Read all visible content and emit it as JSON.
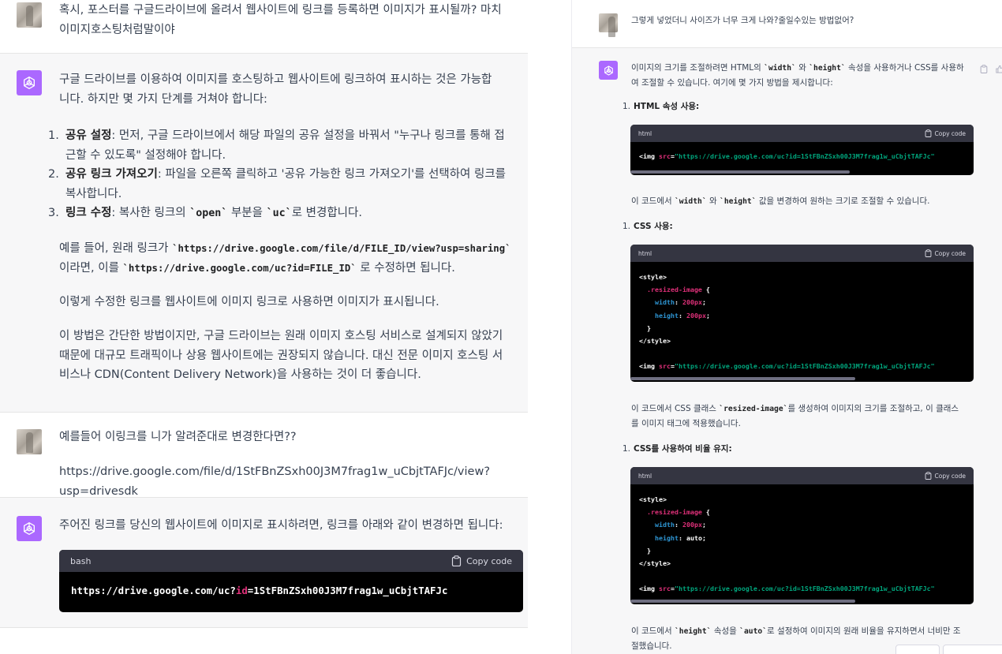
{
  "left": {
    "msg1_user": {
      "line1": "혹시, 포스터를 구글드라이브에 올려서 웹사이트에 링크를 등록하면 이미지가 표시될까? 마치",
      "line2": "이미지호스팅처럼말이야"
    },
    "msg2_bot": {
      "intro1": "구글 드라이브를 이용하여 이미지를 호스팅하고 웹사이트에 링크하여 표시하는 것은 가능합",
      "intro2": "니다. 하지만 몇 가지 단계를 거쳐야 합니다:",
      "steps": [
        {
          "num": "1.",
          "title": "공유 설정",
          "line1": ": 먼저, 구글 드라이브에서 해당 파일의 공유 설정을 바꿔서 \"누구나 링크를 통해 접",
          "line2": "근할 수 있도록\" 설정해야 합니다."
        },
        {
          "num": "2.",
          "title": "공유 링크 가져오기",
          "line1": ": 파일을 오른쪽 클릭하고 '공유 가능한 링크 가져오기'를 선택하여 링크를",
          "line2": "복사합니다."
        },
        {
          "num": "3.",
          "title": "링크 수정",
          "pre": ": 복사한 링크의 ",
          "code1": "`open`",
          "mid": " 부분을 ",
          "code2": "`uc`",
          "post": "로 변경합니다."
        }
      ],
      "example_pre": "예를 들어, 원래 링크가 ",
      "example_code1": "`https://drive.google.com/file/d/FILE_ID/view?usp=sharing`",
      "example_mid": "이라면, 이를 ",
      "example_code2": "`https://drive.google.com/uc?id=FILE_ID`",
      "example_post": " 로 수정하면 됩니다.",
      "para2": "이렇게 수정한 링크를 웹사이트에 이미지 링크로 사용하면 이미지가 표시됩니다.",
      "para3_l1": "이 방법은 간단한 방법이지만, 구글 드라이브는 원래 이미지 호스팅 서비스로 설계되지 않았기",
      "para3_l2": "때문에 대규모 트래픽이나 상용 웹사이트에는 권장되지 않습니다. 대신 전문 이미지 호스팅 서",
      "para3_l3": "비스나 CDN(Content Delivery Network)을 사용하는 것이 더 좋습니다."
    },
    "msg3_user": {
      "line1": "예를들어 이링크를 니가 알려준대로 변경한다면??",
      "line2": "https://drive.google.com/file/d/1StFBnZSxh00J3M7frag1w_uCbjtTAFJc/view?usp=drivesdk"
    },
    "msg4_bot": {
      "text": "주어진 링크를 당신의 웹사이트에 이미지로 표시하려면, 링크를 아래와 같이 변경하면 됩니다:",
      "code_lang": "bash",
      "copy_label": "Copy code",
      "code_pre": "https://drive.google.com/uc?",
      "code_kw": "id",
      "code_post": "=1StFBnZSxh00J3M7frag1w_uCbjtTAFJc"
    }
  },
  "right": {
    "msg1_user": {
      "text": "그렇게 넣었더니 사이즈가 너무 크게 나와?줄일수있는 방법없어?"
    },
    "msg2_bot": {
      "intro_pre": "이미지의 크기를 조절하려면 HTML의 ",
      "intro_c1": "`width`",
      "intro_and": " 와 ",
      "intro_c2": "`height`",
      "intro_post": " 속성을 사용하거나 CSS를 사용하",
      "intro_l2": "여 조절할 수 있습니다. 여기에 몇 가지 방법을 제시합니다:",
      "s1_num": "1.",
      "s1_title": "HTML 속성 사용:",
      "code_lang": "html",
      "copy_label": "Copy code",
      "code1_tag": "<img",
      "code1_attr": "src",
      "code1_eq": "=",
      "code1_str": "\"https://drive.google.com/uc?id=1StFBnZSxh00J3M7frag1w_uCbjtTAFJc\"",
      "after1_pre": "이 코드에서 ",
      "after1_c1": "`width`",
      "after1_and": " 와 ",
      "after1_c2": "`height`",
      "after1_post": " 값을 변경하여 원하는 크기로 조절할 수 있습니다.",
      "s2_num": "1.",
      "s2_title": "CSS 사용:",
      "code2": {
        "l1": "<style>",
        "l2_sel": ".resized-image",
        "l2_brace": " {",
        "l3_prop": "width",
        "l3_colon": ": ",
        "l3_val": "200px",
        "l3_semi": ";",
        "l4_prop": "height",
        "l4_colon": ": ",
        "l4_val": "200px",
        "l4_semi": ";",
        "l5": "}",
        "l6": "</style>",
        "l7_tag": "<img",
        "l7_attr": "src",
        "l7_eq": "=",
        "l7_str": "\"https://drive.google.com/uc?id=1StFBnZSxh00J3M7frag1w_uCbjtTAFJc\""
      },
      "after2_pre": "이 코드에서 CSS 클래스 ",
      "after2_c1": "`resized-image`",
      "after2_post": "를 생성하여 이미지의 크기를 조절하고, 이 클래스",
      "after2_l2": "를 이미지 태그에 적용했습니다.",
      "s3_num": "1.",
      "s3_title": "CSS를 사용하여 비율 유지:",
      "code3": {
        "l1": "<style>",
        "l2_sel": ".resized-image",
        "l2_brace": " {",
        "l3_prop": "width",
        "l3_colon": ": ",
        "l3_val": "200px",
        "l3_semi": ";",
        "l4_prop": "height",
        "l4_colon": ": ",
        "l4_val": "auto;",
        "l5": "}",
        "l6": "</style>",
        "l7_tag": "<img",
        "l7_attr": "src",
        "l7_eq": "=",
        "l7_str": "\"https://drive.google.com/uc?id=1StFBnZSxh00J3M7frag1w_uCbjtTAFJc\""
      },
      "after3_pre": "이 코드에서 ",
      "after3_c1": "`height`",
      "after3_mid": " 속성을 ",
      "after3_c2": "`auto`",
      "after3_post": "로 설정하여 이미지의 원래 비율을 유지하면서 너비만 조",
      "after3_l2": "절했습니다."
    }
  },
  "colors": {
    "bot_avatar": "#ab68ff",
    "bot_bg": "#f7f7f8",
    "code_bg": "#000000",
    "code_header": "#343541",
    "attr": "#df3079",
    "string": "#00a67d"
  }
}
